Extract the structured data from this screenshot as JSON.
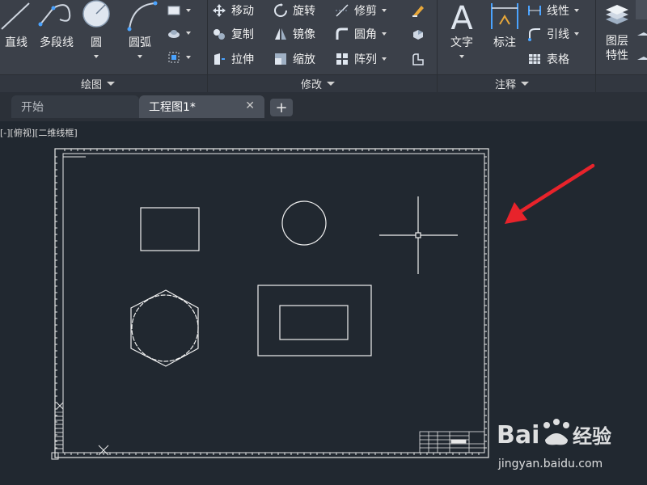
{
  "ribbon": {
    "draw": {
      "title": "绘图",
      "line": "直线",
      "polyline": "多段线",
      "circle": "圆",
      "arc": "圆弧"
    },
    "modify": {
      "title": "修改",
      "move": "移动",
      "rotate": "旋转",
      "trim": "修剪",
      "copy": "复制",
      "mirror": "镜像",
      "fillet": "圆角",
      "stretch": "拉伸",
      "scale": "缩放",
      "array": "阵列"
    },
    "annotation": {
      "title": "注释",
      "text": "文字",
      "dimension": "标注",
      "linear": "线性",
      "leader": "引线",
      "table": "表格"
    },
    "layers": {
      "layer_props": "图层\n特性"
    }
  },
  "tabs": [
    {
      "label": "开始"
    },
    {
      "label": "工程图1*"
    }
  ],
  "viewport_label": "[-][俯视][二维线框]",
  "watermark": {
    "brand": "Bai",
    "brand2": "经验",
    "url": "jingyan.baidu.com"
  },
  "colors": {
    "canvas_bg": "#212830",
    "ribbon_bg": "#3b4049",
    "arrow": "#e8232b"
  }
}
